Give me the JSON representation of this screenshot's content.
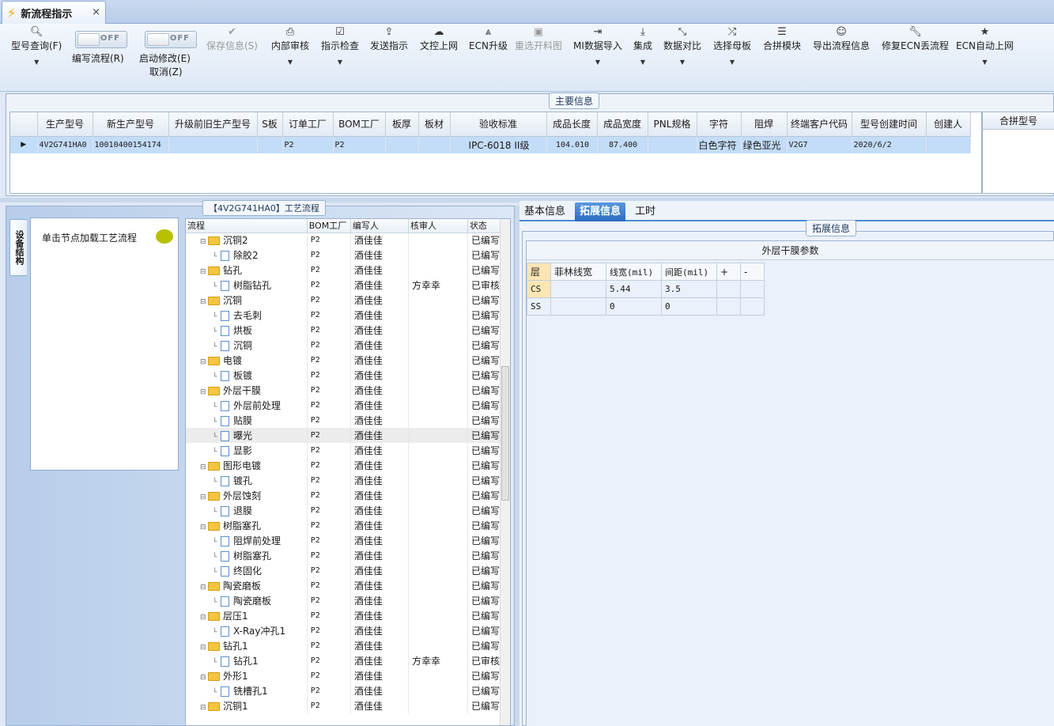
{
  "tab": {
    "title": "新流程指示",
    "close": "×"
  },
  "toolbar": {
    "query": "型号查询(F)",
    "write_flow": "编写流程(R)",
    "start_modify": "启动修改(E)",
    "cancel": "取消(Z)",
    "toggle_off": "OFF",
    "save": "保存信息(S)",
    "internal_review": "内部审核",
    "indicator_check": "指示检查",
    "send": "发送指示",
    "doc_upload": "文控上网",
    "ecn_upgrade": "ECN升级",
    "reselect": "重选开料图",
    "mi_import": "MI数据导入",
    "integrate": "集成",
    "compare": "数据对比",
    "select_mother": "选择母板",
    "merge_module": "合拼模块",
    "export_flow": "导出流程信息",
    "fix_ecn": "修复ECN丢流程",
    "ecn_auto": "ECN自动上网"
  },
  "main_info": {
    "title": "主要信息",
    "columns": [
      "生产型号",
      "新生产型号",
      "升级前旧生产型号",
      "S板",
      "订单工厂",
      "BOM工厂",
      "板厚",
      "板材",
      "验收标准",
      "成品长度",
      "成品宽度",
      "PNL规格",
      "字符",
      "阻焊",
      "终端客户代码",
      "型号创建时间",
      "创建人"
    ],
    "row": [
      "4V2G741HA0",
      "10010400154174",
      "",
      "",
      "P2",
      "P2",
      "",
      "",
      "IPC-6018 II级",
      "104.010",
      "87.400",
      "",
      "白色字符",
      "绿色亚光",
      "V2G7",
      "2020/6/2",
      ""
    ],
    "merge_header": "合拼型号"
  },
  "left": {
    "vtab": "设备结构",
    "hint": "单击节点加载工艺流程",
    "flow_title": "【4V2G741HA0】工艺流程"
  },
  "tree": {
    "headers": [
      "流程",
      "BOM工厂",
      "编写人",
      "核审人",
      "状态"
    ],
    "rows": [
      {
        "kind": "folder",
        "name": "沉铜2",
        "bom": "P2",
        "writer": "酒佳佳",
        "reviewer": "",
        "status": "已编写"
      },
      {
        "kind": "leaf",
        "name": "除胶2",
        "bom": "P2",
        "writer": "酒佳佳",
        "reviewer": "",
        "status": "已编写"
      },
      {
        "kind": "folder",
        "name": "钻孔",
        "bom": "P2",
        "writer": "酒佳佳",
        "reviewer": "",
        "status": "已编写"
      },
      {
        "kind": "leaf",
        "name": "树脂钻孔",
        "bom": "P2",
        "writer": "酒佳佳",
        "reviewer": "方幸幸",
        "status": "已审核"
      },
      {
        "kind": "folder",
        "name": "沉铜",
        "bom": "P2",
        "writer": "酒佳佳",
        "reviewer": "",
        "status": "已编写"
      },
      {
        "kind": "leaf",
        "name": "去毛刺",
        "bom": "P2",
        "writer": "酒佳佳",
        "reviewer": "",
        "status": "已编写"
      },
      {
        "kind": "leaf",
        "name": "烘板",
        "bom": "P2",
        "writer": "酒佳佳",
        "reviewer": "",
        "status": "已编写"
      },
      {
        "kind": "leaf",
        "name": "沉铜",
        "bom": "P2",
        "writer": "酒佳佳",
        "reviewer": "",
        "status": "已编写"
      },
      {
        "kind": "folder",
        "name": "电镀",
        "bom": "P2",
        "writer": "酒佳佳",
        "reviewer": "",
        "status": "已编写"
      },
      {
        "kind": "leaf",
        "name": "板镀",
        "bom": "P2",
        "writer": "酒佳佳",
        "reviewer": "",
        "status": "已编写"
      },
      {
        "kind": "folder",
        "name": "外层干膜",
        "bom": "P2",
        "writer": "酒佳佳",
        "reviewer": "",
        "status": "已编写"
      },
      {
        "kind": "leaf",
        "name": "外层前处理",
        "bom": "P2",
        "writer": "酒佳佳",
        "reviewer": "",
        "status": "已编写"
      },
      {
        "kind": "leaf",
        "name": "贴膜",
        "bom": "P2",
        "writer": "酒佳佳",
        "reviewer": "",
        "status": "已编写"
      },
      {
        "kind": "leaf",
        "name": "曝光",
        "bom": "P2",
        "writer": "酒佳佳",
        "reviewer": "",
        "status": "已编写",
        "hl": true
      },
      {
        "kind": "leaf",
        "name": "显影",
        "bom": "P2",
        "writer": "酒佳佳",
        "reviewer": "",
        "status": "已编写"
      },
      {
        "kind": "folder",
        "name": "图形电镀",
        "bom": "P2",
        "writer": "酒佳佳",
        "reviewer": "",
        "status": "已编写"
      },
      {
        "kind": "leaf",
        "name": "镀孔",
        "bom": "P2",
        "writer": "酒佳佳",
        "reviewer": "",
        "status": "已编写"
      },
      {
        "kind": "folder",
        "name": "外层蚀刻",
        "bom": "P2",
        "writer": "酒佳佳",
        "reviewer": "",
        "status": "已编写"
      },
      {
        "kind": "leaf",
        "name": "退膜",
        "bom": "P2",
        "writer": "酒佳佳",
        "reviewer": "",
        "status": "已编写"
      },
      {
        "kind": "folder",
        "name": "树脂塞孔",
        "bom": "P2",
        "writer": "酒佳佳",
        "reviewer": "",
        "status": "已编写"
      },
      {
        "kind": "leaf",
        "name": "阻焊前处理",
        "bom": "P2",
        "writer": "酒佳佳",
        "reviewer": "",
        "status": "已编写"
      },
      {
        "kind": "leaf",
        "name": "树脂塞孔",
        "bom": "P2",
        "writer": "酒佳佳",
        "reviewer": "",
        "status": "已编写"
      },
      {
        "kind": "leaf",
        "name": "终固化",
        "bom": "P2",
        "writer": "酒佳佳",
        "reviewer": "",
        "status": "已编写"
      },
      {
        "kind": "folder",
        "name": "陶瓷磨板",
        "bom": "P2",
        "writer": "酒佳佳",
        "reviewer": "",
        "status": "已编写"
      },
      {
        "kind": "leaf",
        "name": "陶瓷磨板",
        "bom": "P2",
        "writer": "酒佳佳",
        "reviewer": "",
        "status": "已编写"
      },
      {
        "kind": "folder",
        "name": "层压1",
        "bom": "P2",
        "writer": "酒佳佳",
        "reviewer": "",
        "status": "已编写"
      },
      {
        "kind": "leaf",
        "name": "X-Ray冲孔1",
        "bom": "P2",
        "writer": "酒佳佳",
        "reviewer": "",
        "status": "已编写"
      },
      {
        "kind": "folder",
        "name": "钻孔1",
        "bom": "P2",
        "writer": "酒佳佳",
        "reviewer": "",
        "status": "已编写"
      },
      {
        "kind": "leaf",
        "name": "钻孔1",
        "bom": "P2",
        "writer": "酒佳佳",
        "reviewer": "方幸幸",
        "status": "已审核"
      },
      {
        "kind": "folder",
        "name": "外形1",
        "bom": "P2",
        "writer": "酒佳佳",
        "reviewer": "",
        "status": "已编写"
      },
      {
        "kind": "leaf",
        "name": "铣槽孔1",
        "bom": "P2",
        "writer": "酒佳佳",
        "reviewer": "",
        "status": "已编写"
      },
      {
        "kind": "folder",
        "name": "沉铜1",
        "bom": "P2",
        "writer": "酒佳佳",
        "reviewer": "",
        "status": "已编写"
      }
    ]
  },
  "right": {
    "tabs": [
      "基本信息",
      "拓展信息",
      "工时"
    ],
    "ext_title": "拓展信息",
    "param_title": "外层干膜参数",
    "param_headers": [
      "层",
      "菲林线宽",
      "线宽(mil)",
      "间距(mil)",
      "+",
      "-"
    ],
    "param_rows": [
      [
        "CS",
        "",
        "5.44",
        "3.5",
        "",
        ""
      ],
      [
        "SS",
        "",
        "0",
        "0",
        "",
        ""
      ]
    ]
  }
}
